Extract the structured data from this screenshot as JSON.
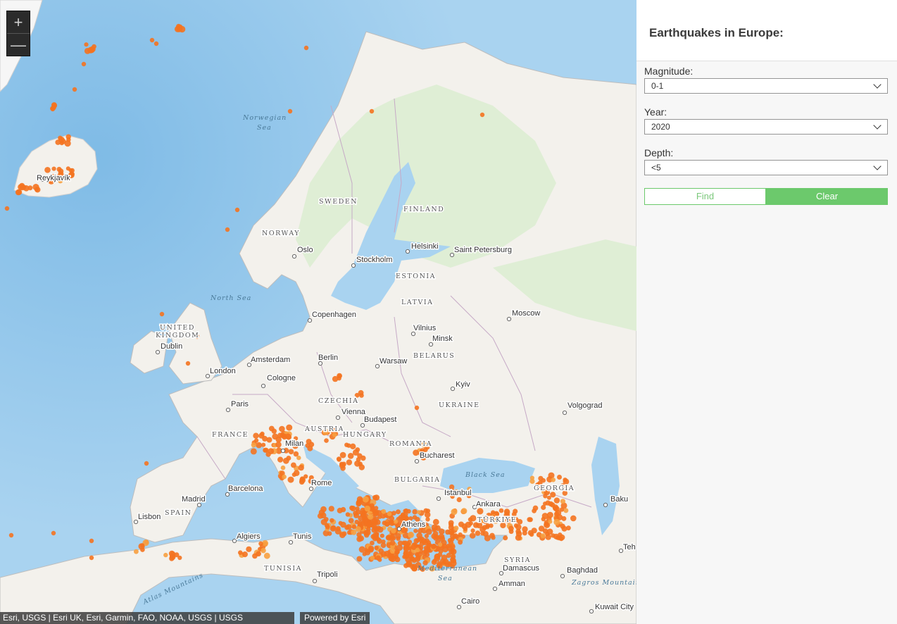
{
  "panel": {
    "title": "Earthquakes in Europe:",
    "magnitude_label": "Magnitude:",
    "magnitude_value": "0-1",
    "year_label": "Year:",
    "year_value": "2020",
    "depth_label": "Depth:",
    "depth_value": "<5",
    "find_label": "Find",
    "clear_label": "Clear"
  },
  "zoom": {
    "in_icon": "plus-icon",
    "out_icon": "minus-icon"
  },
  "attribution": {
    "credits": "Esri, USGS | Esri UK, Esri, Garmin, FAO, NOAA, USGS | USGS Earthquakes",
    "powered": "Powered by Esri"
  },
  "map_labels": {
    "cities": [
      "Reykjavík",
      "Oslo",
      "Stockholm",
      "Helsinki",
      "Saint Petersburg",
      "Copenhagen",
      "Moscow",
      "Dublin",
      "London",
      "Amsterdam",
      "Berlin",
      "Cologne",
      "Warsaw",
      "Vilnius",
      "Minsk",
      "Kyiv",
      "Paris",
      "Vienna",
      "Budapest",
      "Volgograd",
      "Milan",
      "Bucharest",
      "Rome",
      "Barcelona",
      "Madrid",
      "Lisbon",
      "Istanbul",
      "Ankara",
      "Baku",
      "Athens",
      "Algiers",
      "Tunis",
      "Tripoli",
      "Damascus",
      "Amman",
      "Baghdad",
      "Cairo",
      "Kuwait City",
      "Teh"
    ],
    "countries": [
      "SWEDEN",
      "FINLAND",
      "NORWAY",
      "ESTONIA",
      "LATVIA",
      "UNITED",
      "KINGDOM",
      "BELARUS",
      "CZECHIA",
      "UKRAINE",
      "AUSTRIA",
      "HUNGARY",
      "ROMANIA",
      "FRANCE",
      "BULGARIA",
      "SPAIN",
      "GEORGIA",
      "TÜRKIYE",
      "TUNISIA",
      "SYRIA"
    ],
    "seas": [
      "Norwegian",
      "Sea",
      "North Sea",
      "Black Sea",
      "Mediterranean",
      "Sea",
      "Atlas Mountains",
      "Zagros Mountains"
    ]
  },
  "colors": {
    "land": "#f3f1ec",
    "forest": "#dfeed5",
    "water": "#a9d3f0",
    "quake": "#f47320",
    "accent": "#6cc96c"
  }
}
